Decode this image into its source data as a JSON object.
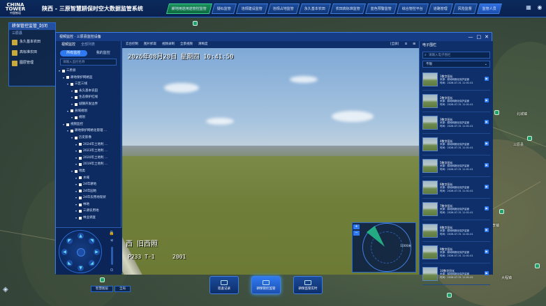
{
  "header": {
    "logo_brand": "CHINA TOWER",
    "logo_sub": "中国铁塔",
    "title": "陕西 - 三原智慧耕保时空大数据监管系统",
    "nav_tabs": [
      "耕地用途用途管控监管",
      "疑似监管",
      "违规建设监管",
      "违规占地监管",
      "永久基本农田",
      "农田高标准监管",
      "蓝色预警监管",
      "综合管控平台",
      "道路管理",
      "风险监督",
      "综合研判平台",
      "地理信息查询平台",
      "视频监控监管"
    ],
    "active_tab_index": 0,
    "user_chip": "监管人员"
  },
  "side_panel": {
    "title": "耕保管控监管_封闭",
    "subtitle": "三原县",
    "items": [
      "永久基本农田",
      "高标准农田",
      "图层管理"
    ]
  },
  "modal": {
    "title": "视频监控 · 三原县监控设备",
    "controls": [
      "—",
      "□",
      "✕"
    ]
  },
  "tree": {
    "tabs": [
      "视频监控",
      "全部列表"
    ],
    "segments": [
      "所有监控",
      "我的监控"
    ],
    "search_placeholder": "请输入监控名称",
    "nodes": [
      {
        "label": "三原县",
        "depth": 0
      },
      {
        "label": "耕地保护网格监",
        "depth": 1
      },
      {
        "label": "三区三线",
        "depth": 2
      },
      {
        "label": "永久基本农田",
        "depth": 3
      },
      {
        "label": "生态保护红线",
        "depth": 3
      },
      {
        "label": "城镇开发边界",
        "depth": 3
      },
      {
        "label": "县域规划",
        "depth": 2
      },
      {
        "label": "规划",
        "depth": 3
      },
      {
        "label": "视频监控",
        "depth": 1
      },
      {
        "label": "耕地保护网格化管理 ...",
        "depth": 2
      },
      {
        "label": "历史影像",
        "depth": 3
      },
      {
        "label": "2024年土地利 ...",
        "depth": 4
      },
      {
        "label": "2023年土地利 ...",
        "depth": 4
      },
      {
        "label": "2020年土地利 ...",
        "depth": 4
      },
      {
        "label": "2019年土地利 ...",
        "depth": 4
      },
      {
        "label": "地类",
        "depth": 3
      },
      {
        "label": "水域",
        "depth": 4
      },
      {
        "label": "24年耕地",
        "depth": 4
      },
      {
        "label": "24年园地",
        "depth": 4
      },
      {
        "label": "24年农用地现状",
        "depth": 4
      },
      {
        "label": "林地",
        "depth": 4
      },
      {
        "label": "三调农用地",
        "depth": 4
      },
      {
        "label": "林业调查",
        "depth": 4
      }
    ]
  },
  "video": {
    "toolbar": [
      "云台控制",
      "图片抓取",
      "视频录制",
      "全景视频",
      "清晰度"
    ],
    "toolbar_right": [
      "[全屏]",
      "⊡",
      "⊞"
    ],
    "osd_time": "2026年08月20日 星期四 10:41:50",
    "osd_name": "西 旧西照",
    "osd_code": "P233 T-1",
    "osd_num": "2001",
    "radar_distance": "1000米",
    "radar_buttons": [
      "+",
      "−"
    ]
  },
  "right_list": {
    "title": "电子围栏",
    "search_placeholder": "请输入电子围栏",
    "select_value": "不限",
    "cameras": [
      {
        "name": "1数字田长",
        "source": "来源：耕地网格化保护监管",
        "time": "时间：2026-07-31 11:01:41"
      },
      {
        "name": "2数字田长",
        "source": "来源：耕地网格化保护监管",
        "time": "时间：2026-07-31 11:01:41"
      },
      {
        "name": "3数字田长",
        "source": "来源：耕地网格化保护监管",
        "time": "时间：2026-07-31 11:01:41"
      },
      {
        "name": "4数字田长",
        "source": "来源：耕地网格化保护监管",
        "time": "时间：2026-07-31 11:01:41"
      },
      {
        "name": "5数字田长",
        "source": "来源：耕地网格化保护监管",
        "time": "时间：2026-07-31 11:01:41"
      },
      {
        "name": "6数字田长",
        "source": "来源：耕地网格化保护监管",
        "time": "时间：2026-07-31 11:01:41"
      },
      {
        "name": "7数字田长",
        "source": "来源：耕地网格化保护监管",
        "time": "时间：2026-07-31 11:01:41"
      },
      {
        "name": "8数字田长",
        "source": "来源：耕地网格化保护监管",
        "time": "时间：2026-07-31 11:01:41"
      },
      {
        "name": "9数字田长",
        "source": "来源：耕地网格化保护监管",
        "time": "时间：2026-07-31 11:01:41"
      },
      {
        "name": "10数字田长",
        "source": "来源：耕地网格化保护监管",
        "time": "时间：2026-07-31 11:01:41"
      }
    ]
  },
  "dock": [
    "巡查记录",
    "耕保管控监管",
    "耕保监管实时"
  ],
  "dock_active_index": 1,
  "bottom_left": [
    "智慧图层",
    "全局"
  ],
  "map_labels": [
    {
      "text": "三原县",
      "cls": "a"
    },
    {
      "text": "北城镇",
      "cls": "b"
    },
    {
      "text": "大程镇",
      "cls": "c"
    },
    {
      "text": "独李镇",
      "cls": "d"
    }
  ],
  "colors": {
    "accent": "#2f7af0",
    "active_green": "#1a8f5a",
    "panel": "#0e2f6a"
  }
}
